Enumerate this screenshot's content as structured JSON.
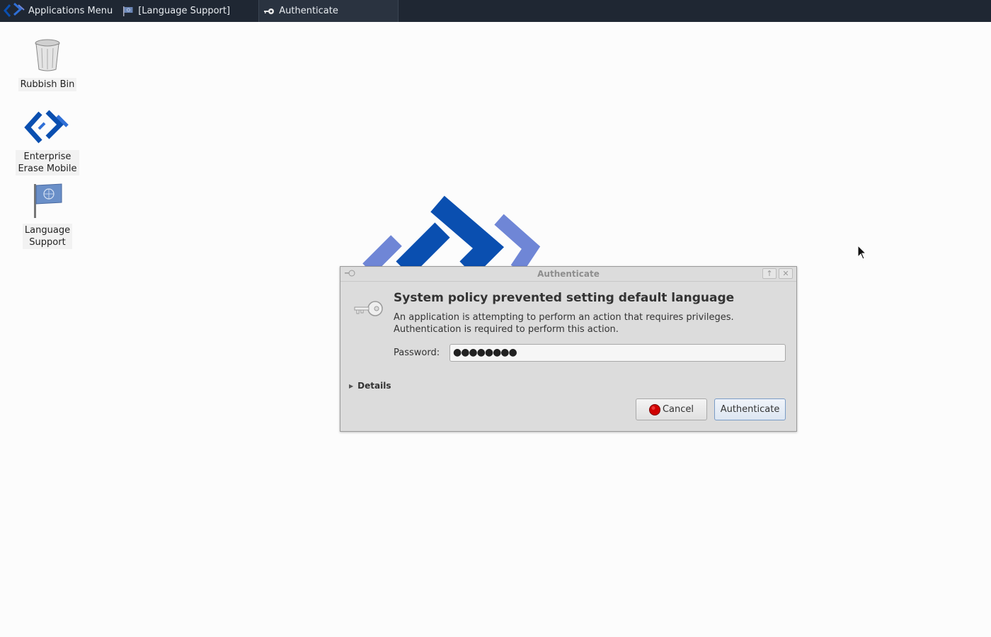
{
  "panel": {
    "apps_menu_label": "Applications Menu",
    "tasks": [
      {
        "label": "[Language Support]"
      },
      {
        "label": "Authenticate"
      }
    ]
  },
  "desktop": {
    "icons": [
      {
        "label": "Rubbish Bin"
      },
      {
        "label": "Enterprise\nErase Mobile"
      },
      {
        "label": "Language\nSupport"
      }
    ]
  },
  "dialog": {
    "title": "Authenticate",
    "heading": "System policy prevented setting default language",
    "description_line1": "An application is attempting to perform an action that requires privileges.",
    "description_line2": "Authentication is required to perform this action.",
    "password_label": "Password:",
    "password_value": "●●●●●●●●",
    "details_label": "Details",
    "cancel_label": "Cancel",
    "authenticate_label": "Authenticate"
  },
  "colors": {
    "panel_bg": "#1f2733",
    "brand_blue": "#0a4fb0",
    "brand_light": "#6f86d6",
    "dialog_bg": "#dcdcdc"
  }
}
